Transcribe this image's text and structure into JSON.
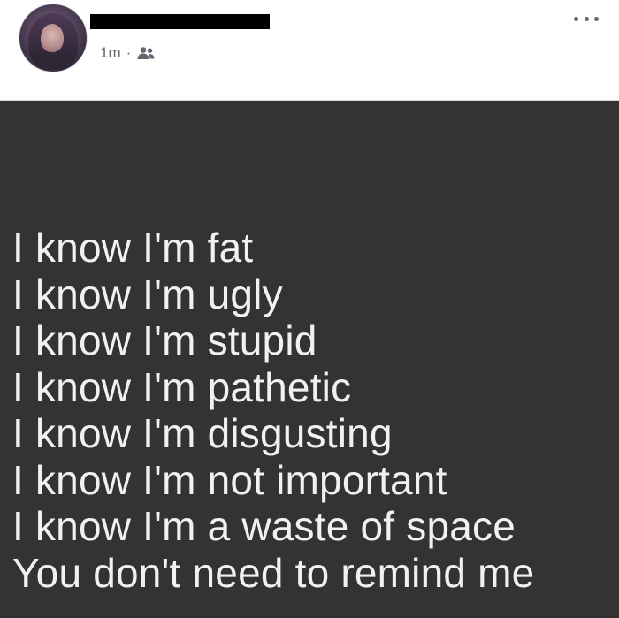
{
  "post": {
    "header": {
      "author_name": "",
      "timestamp": "1m",
      "separator": "·",
      "audience_icon": "friends-icon",
      "more_icon": "more-options-icon"
    },
    "body": {
      "background": "#333333",
      "text_color": "#f1f1f1",
      "lines": [
        "I know I'm fat",
        "I know I'm ugly",
        "I know I'm stupid",
        "I know I'm pathetic",
        "I know I'm disgusting",
        "I know I'm not important",
        "I know I'm a waste of space",
        "You don't need to remind me"
      ]
    }
  }
}
